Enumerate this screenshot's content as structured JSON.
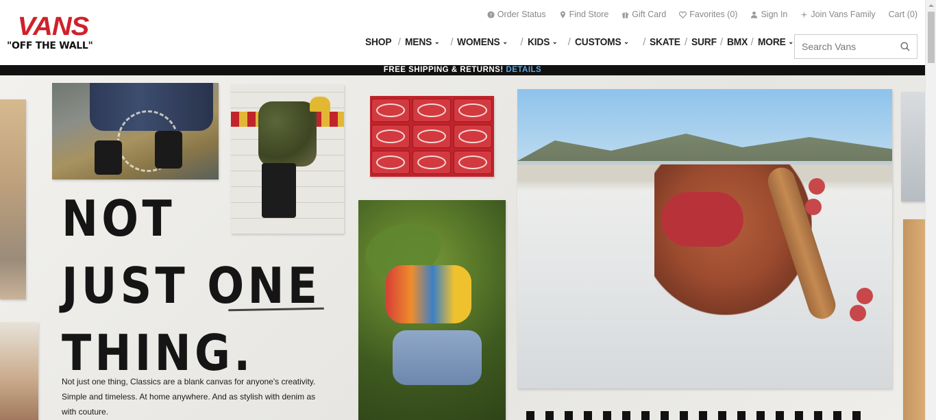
{
  "brand": {
    "logo_word": "VANS",
    "logo_tagline": "\"OFF THE WALL\"",
    "brand_color": "#d0212b"
  },
  "utility_nav": {
    "order_status": "Order Status",
    "find_store": "Find Store",
    "gift_card": "Gift Card",
    "favorites": "Favorites (0)",
    "sign_in": "Sign In",
    "join": "Join Vans Family",
    "cart": "Cart (0)"
  },
  "main_nav": {
    "shop": "SHOP",
    "mens": "MENS",
    "womens": "WOMENS",
    "kids": "KIDS",
    "customs": "CUSTOMS",
    "skate": "SKATE",
    "surf": "SURF",
    "bmx": "BMX",
    "more": "MORE",
    "separator": "/",
    "chevron": "⌄"
  },
  "search": {
    "placeholder": "Search Vans"
  },
  "promo": {
    "text": "FREE SHIPPING & RETURNS!",
    "link": "DETAILS",
    "link_color": "#5fa6df"
  },
  "hero": {
    "headline_line1": "NOT",
    "headline_line2": "JUST ONE",
    "headline_line3": "THING.",
    "body": "Not just one thing, Classics are a blank canvas for anyone's creativity. Simple and timeless. At home anywhere. And as stylish with denim as with couture."
  }
}
